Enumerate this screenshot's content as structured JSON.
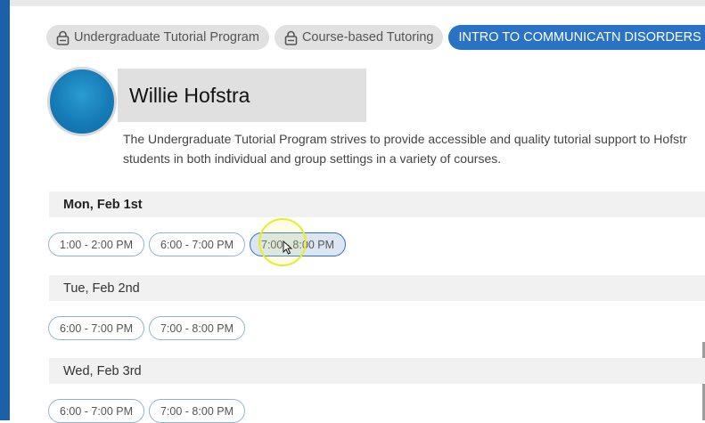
{
  "chips": [
    {
      "label": "Undergraduate Tutorial Program",
      "icon": "lock-icon"
    },
    {
      "label": "Course-based Tutoring",
      "icon": "lock-icon"
    }
  ],
  "active_chip": {
    "label": "INTRO TO COMMUNICATN DISORDERS",
    "close_icon": "×"
  },
  "profile": {
    "name": "Willie Hofstra",
    "description_line1": "The Undergraduate Tutorial Program strives to provide accessible and quality tutorial support to Hofstr",
    "description_line2": "students in both individual and group settings in a variety of courses."
  },
  "days": [
    {
      "label": "Mon, Feb 1st",
      "slots": [
        "1:00 - 2:00 PM",
        "6:00 - 7:00 PM",
        "7:00 - 8:00 PM"
      ]
    },
    {
      "label": "Tue, Feb 2nd",
      "slots": [
        "6:00 - 7:00 PM",
        "7:00 - 8:00 PM"
      ]
    },
    {
      "label": "Wed, Feb 3rd",
      "slots": [
        "6:00 - 7:00 PM",
        "7:00 - 8:00 PM"
      ]
    }
  ],
  "colors": {
    "accent": "#2a73c4",
    "chip_bg": "#e1e1e1",
    "header_bg": "#f1f1f1",
    "slot_border": "#8db3d8"
  }
}
